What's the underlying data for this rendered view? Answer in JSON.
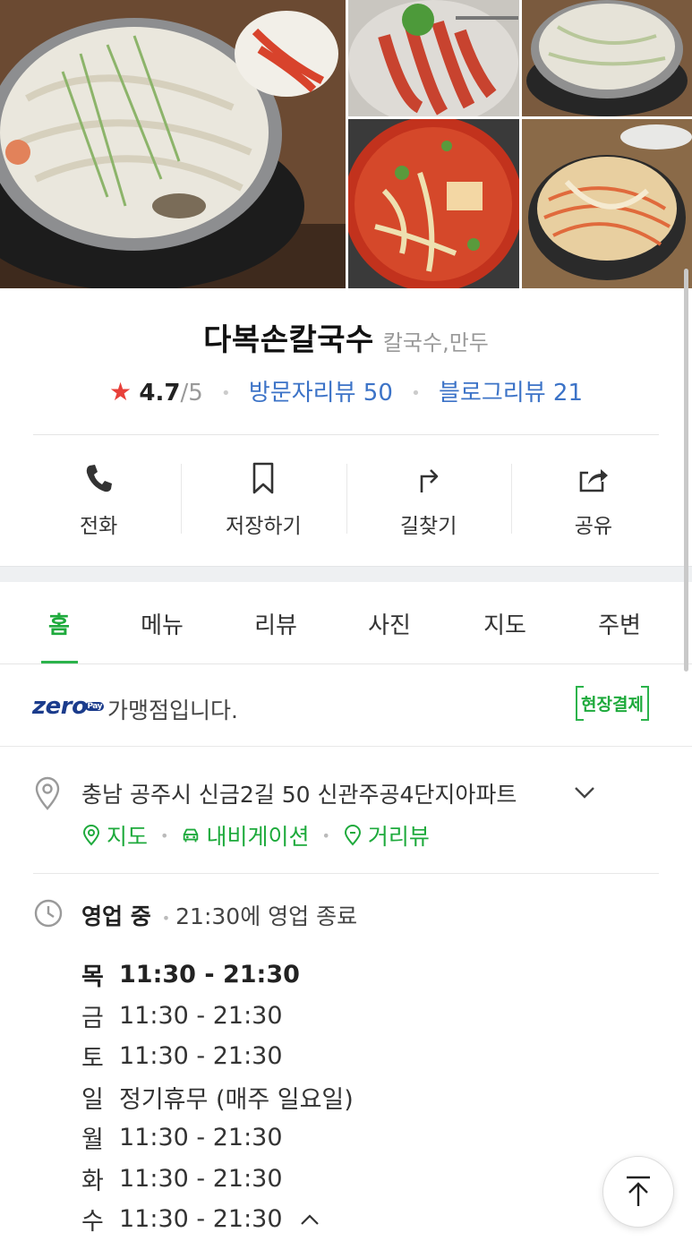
{
  "photos": [
    {
      "name": "dish-main-photo",
      "icon": "photo-kalguksu"
    },
    {
      "name": "dish-photo-2",
      "icon": "photo-squid"
    },
    {
      "name": "dish-photo-3",
      "icon": "photo-noodle-pot"
    },
    {
      "name": "dish-photo-4",
      "icon": "photo-red-stew"
    },
    {
      "name": "dish-photo-5",
      "icon": "photo-spicy-noodles"
    }
  ],
  "place": {
    "name": "다복손칼국수",
    "category": "칼국수,만두",
    "rating": "4.7",
    "rating_max": "/5",
    "visitor_reviews": "방문자리뷰 50",
    "blog_reviews": "블로그리뷰 21"
  },
  "actions": [
    {
      "label": "전화",
      "icon": "phone-icon"
    },
    {
      "label": "저장하기",
      "icon": "bookmark-icon"
    },
    {
      "label": "길찾기",
      "icon": "directions-icon"
    },
    {
      "label": "공유",
      "icon": "share-icon"
    }
  ],
  "tabs": [
    "홈",
    "메뉴",
    "리뷰",
    "사진",
    "지도",
    "주변"
  ],
  "active_tab": "홈",
  "zeropay": {
    "logo": "zero",
    "logo_badge": "Pay",
    "text": "가맹점입니다.",
    "badge": "현장결제"
  },
  "address": {
    "text": "충남 공주시 신금2길 50 신관주공4단지아파트",
    "links": [
      "지도",
      "내비게이션",
      "거리뷰"
    ]
  },
  "hours": {
    "status": "영업 중",
    "detail": "21:30에 영업 종료",
    "rows": [
      {
        "day": "목",
        "time": "11:30 - 21:30"
      },
      {
        "day": "금",
        "time": "11:30 - 21:30"
      },
      {
        "day": "토",
        "time": "11:30 - 21:30"
      },
      {
        "day": "일",
        "time": "정기휴무 (매주 일요일)"
      },
      {
        "day": "월",
        "time": "11:30 - 21:30"
      },
      {
        "day": "화",
        "time": "11:30 - 21:30"
      },
      {
        "day": "수",
        "time": "11:30 - 21:30"
      }
    ]
  },
  "colors": {
    "accent_green": "#1eaa3c",
    "link_blue": "#3c73c7",
    "star_red": "#e8403a",
    "zeropay_navy": "#1b3c8c"
  }
}
